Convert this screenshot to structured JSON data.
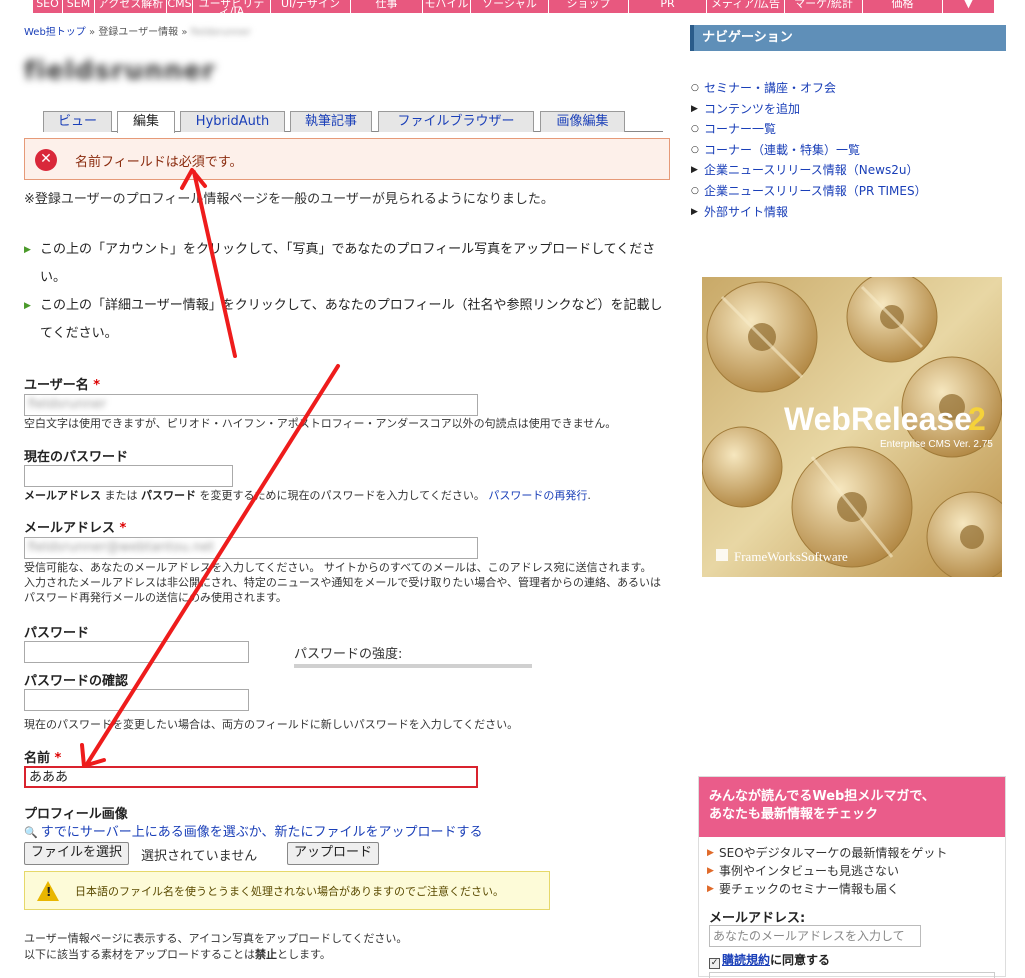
{
  "topnav": {
    "items": [
      "SEO",
      "SEM",
      "アクセス解析",
      "CMS",
      "ユーザビリティ/IA",
      "UI/デザイン",
      "仕事",
      "モバイル",
      "ソーシャル",
      "ショップ",
      "PR",
      "メディア/広告",
      "マーケ/統計",
      "価格"
    ],
    "more_icon": "caret-down-icon",
    "color": "#e8587f"
  },
  "breadcrumb": {
    "home": "Web担トップ",
    "sep": "»",
    "section": "登録ユーザー情報",
    "user": "fieldsrunner"
  },
  "page_title": "fieldsrunner",
  "tabs": [
    "ビュー",
    "編集",
    "HybridAuth",
    "執筆記事",
    "ファイルブラウザー",
    "画像編集"
  ],
  "error": {
    "icon": "error-x-icon",
    "message": "名前フィールドは必須です。",
    "color": "#d9283a"
  },
  "notice": "※登録ユーザーのプロフィール情報ページを一般のユーザーが見られるようになりました。",
  "bullets": [
    "この上の「アカウント」をクリックして、「写真」であなたのプロフィール写真をアップロードしてください。",
    "この上の「詳細ユーザー情報」をクリックして、あなたのプロフィール（社名や参照リンクなど）を記載してください。"
  ],
  "form": {
    "required_mark": "*",
    "username": {
      "label": "ユーザー名",
      "value": "fieldsrunner",
      "desc": "空白文字は使用できますが、ピリオド・ハイフン・アポストロフィー・アンダースコア以外の句読点は使用できません。"
    },
    "current_password": {
      "label": "現在のパスワード",
      "value": "",
      "desc_1": "メールアドレス",
      "desc_2": " または ",
      "desc_3": "パスワード",
      "desc_4": " を変更するために現在のパスワードを入力してください。",
      "reset_link": "パスワードの再発行",
      "desc_end": "."
    },
    "email": {
      "label": "メールアドレス",
      "value": "fieldsrunner@webtantou.net",
      "desc": "受信可能な、あなたのメールアドレスを入力してください。 サイトからのすべてのメールは、このアドレス宛に送信されます。 入力されたメールアドレスは非公開にされ、特定のニュースや通知をメールで受け取りたい場合や、管理者からの連絡、あるいはパスワード再発行メールの送信にのみ使用されます。"
    },
    "password": {
      "label": "パスワード",
      "strength_label": "パスワードの強度:"
    },
    "password_confirm": {
      "label": "パスワードの確認",
      "desc": "現在のパスワードを変更したい場合は、両方のフィールドに新しいパスワードを入力してください。"
    },
    "name": {
      "label": "名前",
      "value": "あああ"
    },
    "profile_image": {
      "label": "プロフィール画像",
      "browse_link": "すでにサーバー上にある画像を選ぶか、新たにファイルをアップロードする",
      "choose_file": "ファイルを選択",
      "no_file": "選択されていません",
      "upload": "アップロード",
      "warning": "日本語のファイル名を使うとうまく処理されない場合がありますのでご注意ください。",
      "warn_icon": "warning-triangle-icon"
    },
    "footnote_1": "ユーザー情報ページに表示する、アイコン写真をアップロードしてください。",
    "footnote_2a": "以下に該当する素材をアップロードすることは",
    "footnote_2b": "禁止",
    "footnote_2c": "とします。"
  },
  "sidebar": {
    "nav_title": "ナビゲーション",
    "nav_items": [
      {
        "label": "セミナー・講座・オフ会",
        "marker": "circle"
      },
      {
        "label": "コンテンツを追加",
        "marker": "triangle"
      },
      {
        "label": "コーナー一覧",
        "marker": "circle"
      },
      {
        "label": "コーナー（連載・特集）一覧",
        "marker": "circle"
      },
      {
        "label": "企業ニュースリリース情報（News2u）",
        "marker": "triangle"
      },
      {
        "label": "企業ニュースリリース情報（PR TIMES）",
        "marker": "circle"
      },
      {
        "label": "外部サイト情報",
        "marker": "triangle"
      }
    ],
    "banner": {
      "title_a": "WebRelease",
      "title_b": "2",
      "subtitle": "Enterprise CMS Ver. 2.75",
      "company": "FrameWorksSoftware"
    },
    "newsletter": {
      "title_1": "みんなが読んでるWeb担メルマガで、",
      "title_2": "あなたも最新情報をチェック",
      "items": [
        "SEOやデジタルマーケの最新情報をゲット",
        "事例やインタビューも見逃さない",
        "要チェックのセミナー情報も届く"
      ],
      "email_label": "メールアドレス:",
      "email_placeholder": "あなたのメールアドレスを入力して",
      "agree_link": "購読規約",
      "agree_text": "に同意する",
      "header_color": "#ea5c8a"
    }
  }
}
